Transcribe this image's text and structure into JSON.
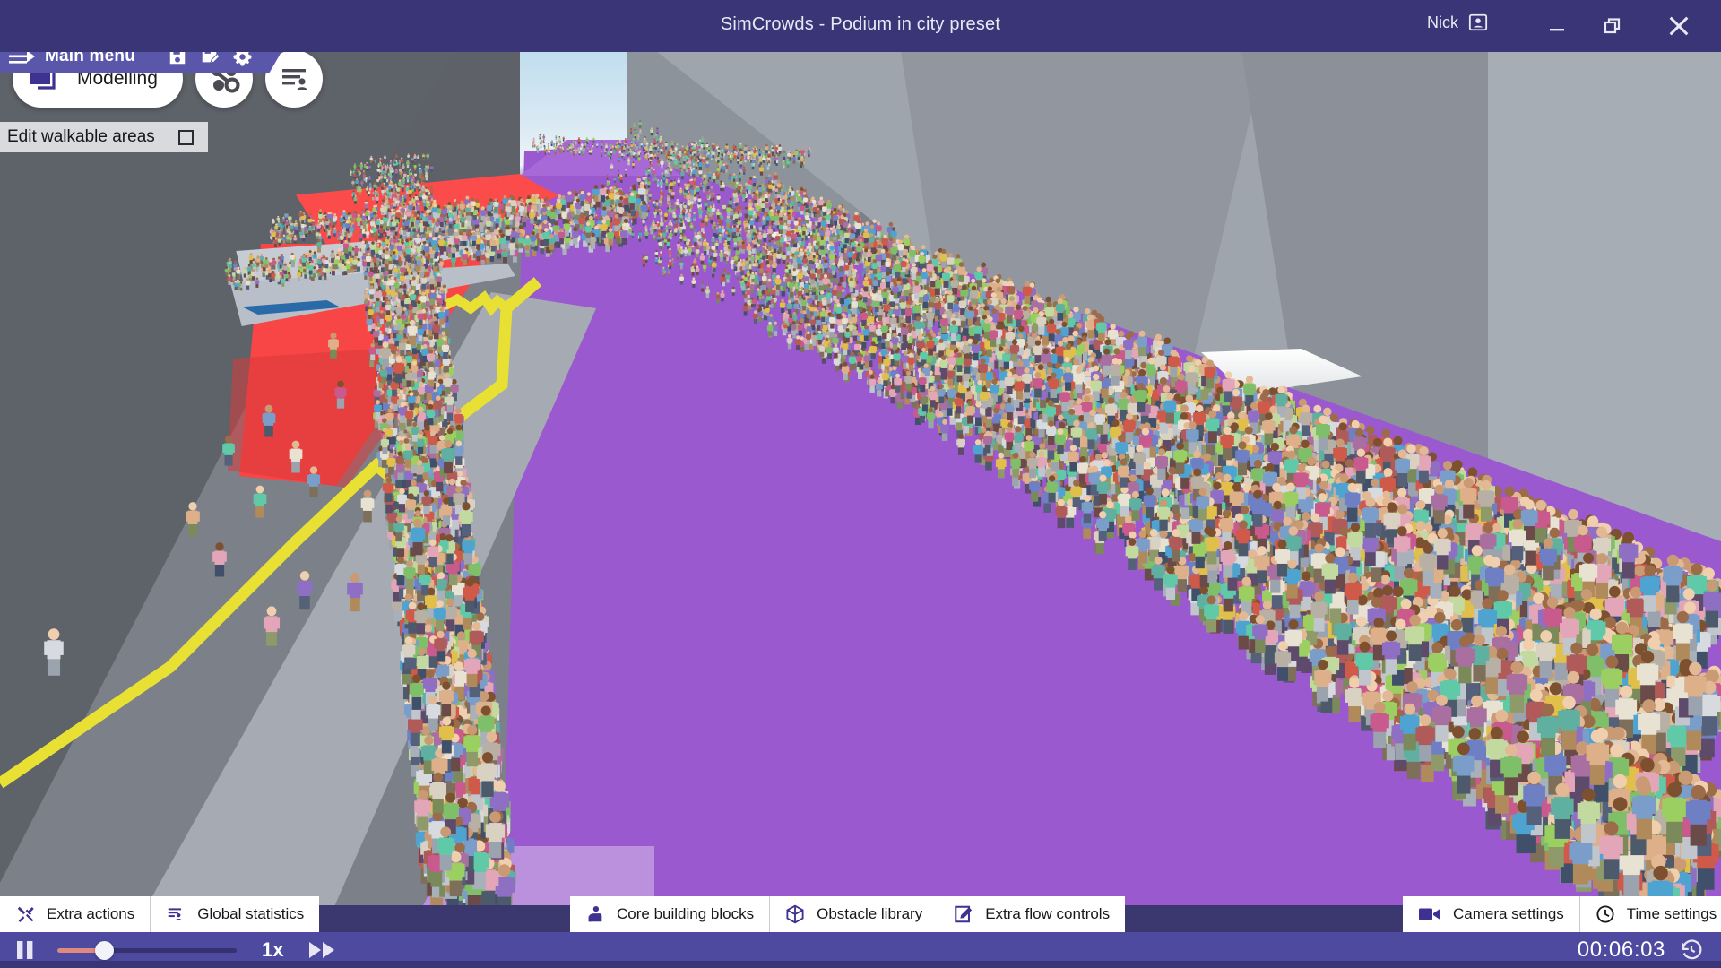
{
  "window": {
    "title": "SimCrowds - Podium in city preset",
    "user_name": "Nick",
    "user_icon": "contact-card-icon",
    "minimize_icon": "minimize-icon",
    "restore_icon": "restore-icon",
    "close_icon": "close-icon"
  },
  "menubar": {
    "main_menu_label": "Main menu",
    "menu_icon": "menu-arrow-icon",
    "save_icon": "save-icon",
    "save_as_icon": "save-as-icon",
    "settings_icon": "gear-icon"
  },
  "toolbar": {
    "mode_label": "Modelling",
    "mode_icon": "layers-icon",
    "flow_button_icon": "node-graph-icon",
    "profiles_button_icon": "list-person-icon",
    "edit_walkable_label": "Edit walkable areas",
    "edit_walkable_checked": false
  },
  "bottom_bar": {
    "left_group": [
      {
        "label": "Extra actions",
        "icon": "tools-icon"
      },
      {
        "label": "Global statistics",
        "icon": "list-person-icon"
      }
    ],
    "center_group": [
      {
        "label": "Core building blocks",
        "icon": "person-block-icon"
      },
      {
        "label": "Obstacle library",
        "icon": "cube-icon"
      },
      {
        "label": "Extra flow controls",
        "icon": "pencil-square-icon"
      }
    ],
    "right_group": [
      {
        "label": "Camera settings",
        "icon": "video-camera-icon"
      },
      {
        "label": "Time settings",
        "icon": "clock-icon"
      }
    ]
  },
  "playback": {
    "pause_icon": "pause-icon",
    "fast_forward_icon": "fast-forward-icon",
    "speed_label": "1x",
    "speed_slider_percent": 26,
    "timer": "00:06:03",
    "reset_time_icon": "history-reset-icon"
  },
  "colors": {
    "titlebar": "#3a3576",
    "menubar": "#5a57ab",
    "playbar": "#4d4aa0",
    "accent_purple": "#4a3f9e",
    "walkable_area": "#9b59d0",
    "restricted_area": "#f84545",
    "boundary_line": "#e8e033",
    "slider_fill": "#e08a7d"
  },
  "scene": {
    "description": "3D crowd simulation viewport: podium in a city street",
    "walkable_area_label": "walkable-area-overlay",
    "restricted_area_label": "podium-restricted-area",
    "boundary_label": "walkable-boundary-line"
  }
}
